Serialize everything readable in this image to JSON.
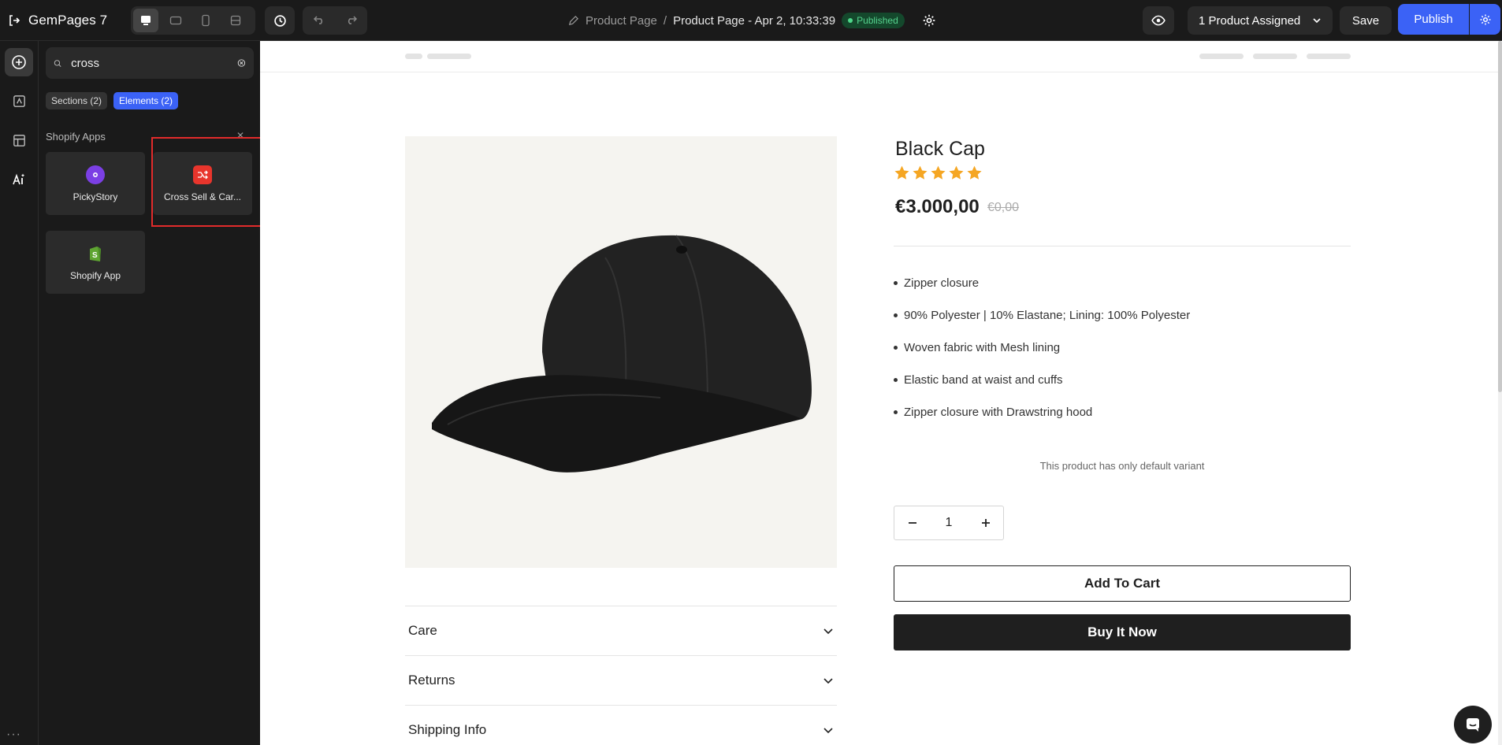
{
  "topbar": {
    "brand": "GemPages 7",
    "breadcrumb_parent": "Product Page",
    "breadcrumb_separator": "/",
    "breadcrumb_current": "Product Page - Apr 2, 10:33:39",
    "status_badge": "Published",
    "assigned_label": "1 Product Assigned",
    "save_label": "Save",
    "publish_label": "Publish"
  },
  "sidebar": {
    "search_value": "cross",
    "tabs": [
      {
        "label": "Sections (2)"
      },
      {
        "label": "Elements (2)"
      }
    ],
    "group_title": "Shopify Apps",
    "apps": [
      {
        "label": "PickyStory",
        "icon": "pickystory-icon"
      },
      {
        "label": "Cross Sell & Car...",
        "icon": "cross-sell-icon"
      },
      {
        "label": "Shopify App",
        "icon": "shopify-icon"
      }
    ]
  },
  "product": {
    "title": "Black Cap",
    "rating": 5,
    "price": "€3.000,00",
    "compare_price": "€0,00",
    "features": [
      "Zipper closure",
      "90% Polyester | 10% Elastane; Lining: 100% Polyester",
      "Woven fabric with Mesh lining",
      "Elastic band at waist and cuffs",
      "Zipper closure with Drawstring hood"
    ],
    "variant_note": "This product has only default variant",
    "quantity": "1",
    "add_to_cart": "Add To Cart",
    "buy_now": "Buy It Now",
    "accordions": [
      {
        "label": "Care"
      },
      {
        "label": "Returns"
      },
      {
        "label": "Shipping Info"
      }
    ]
  },
  "colors": {
    "accent": "#3b62f6",
    "published": "#56d38e",
    "highlight": "#e22b2b",
    "star": "#f5a623"
  }
}
